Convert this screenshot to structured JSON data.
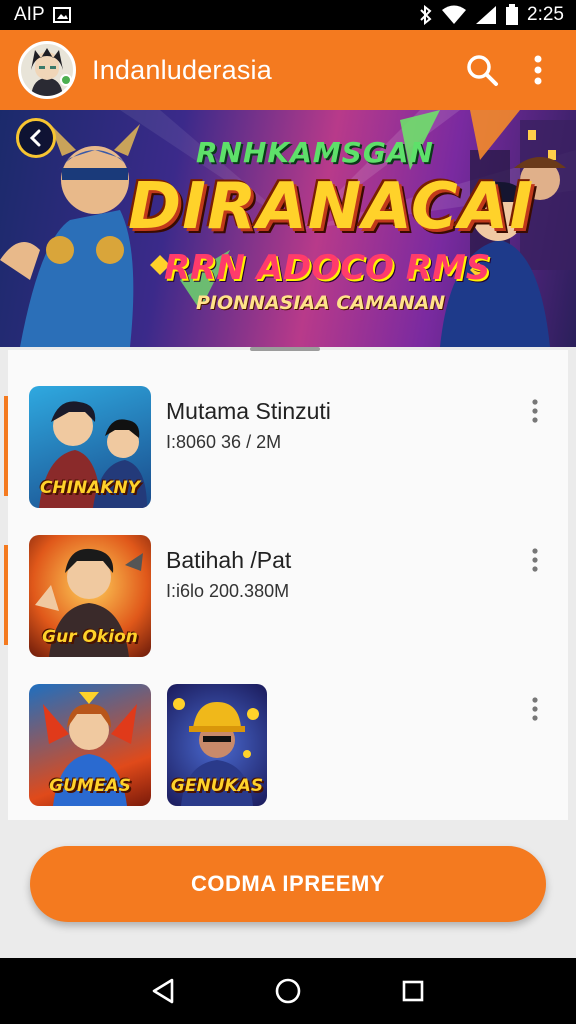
{
  "status_bar": {
    "left_text": "AIP",
    "time": "2:25",
    "icons": [
      "image-icon",
      "bluetooth-icon",
      "wifi-icon",
      "signal-icon",
      "battery-icon"
    ]
  },
  "app_bar": {
    "title": "Indanluderasia",
    "accent_color": "#f47a1f",
    "icons": [
      "avatar",
      "search-icon",
      "more-vert-icon"
    ]
  },
  "banner": {
    "top_text": "RNHKAMSGAN",
    "main_text": "DIRANACAI",
    "sub_text": "RRN ADOCO RMS",
    "tag_text": "PIONNASIAA CAMANAN"
  },
  "list": {
    "items": [
      {
        "title": "Mutama Stinzuti",
        "meta": "I:8060 36 / 2M",
        "thumb_label": "CHINAKNY"
      },
      {
        "title": "Batihah /Pat",
        "meta": "I:i6lo 200.380M",
        "thumb_label": "Gur Okion"
      },
      {
        "title": "",
        "meta": "",
        "thumb_label": "GUMEAS",
        "extra_thumb_label": "GENUKAS"
      }
    ]
  },
  "cta": {
    "label": "CODMA IPREEMY"
  }
}
